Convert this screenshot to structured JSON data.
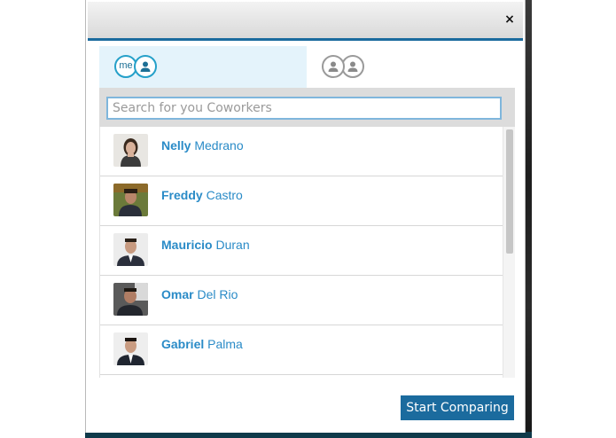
{
  "modal": {
    "close_label": "×"
  },
  "tabs": {
    "me_label": "me"
  },
  "search": {
    "placeholder": "Search for you Coworkers",
    "value": ""
  },
  "coworkers": [
    {
      "first": "Nelly",
      "last": "Medrano"
    },
    {
      "first": "Freddy",
      "last": "Castro"
    },
    {
      "first": "Mauricio",
      "last": "Duran"
    },
    {
      "first": "Omar",
      "last": "Del Rio"
    },
    {
      "first": "Gabriel",
      "last": "Palma"
    }
  ],
  "actions": {
    "start_label": "Start Comparing"
  },
  "colors": {
    "accent": "#1b6b9e",
    "name_link": "#2a8bc7",
    "me_ring": "#25a0c9",
    "active_tab_bg": "#e4f3fb"
  }
}
